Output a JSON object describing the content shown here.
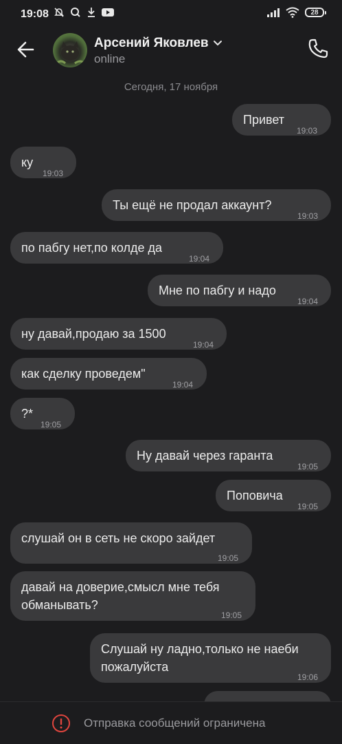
{
  "status_bar": {
    "time": "19:08",
    "battery": "28"
  },
  "header": {
    "contact_name": "Арсений Яковлев",
    "presence": "online"
  },
  "date_separator": "Сегодня, 17 ноября",
  "messages": [
    {
      "dir": "out",
      "text": "Привет",
      "time": "19:03"
    },
    {
      "dir": "in",
      "text": "ку",
      "time": "19:03"
    },
    {
      "dir": "out",
      "text": "Ты ещё не продал аккаунт?",
      "time": "19:03"
    },
    {
      "dir": "in",
      "text": "по пабгу нет,по колде да",
      "time": "19:04"
    },
    {
      "dir": "out",
      "text": "Мне по пабгу и надо",
      "time": "19:04"
    },
    {
      "dir": "in",
      "text": "ну давай,продаю за 1500",
      "time": "19:04"
    },
    {
      "dir": "in",
      "text": "как сделку проведем\"",
      "time": "19:04"
    },
    {
      "dir": "in",
      "text": "?*",
      "time": "19:05"
    },
    {
      "dir": "out",
      "text": "Ну давай через гаранта",
      "time": "19:05"
    },
    {
      "dir": "out",
      "text": "Поповича",
      "time": "19:05"
    },
    {
      "dir": "in",
      "text": "слушай он в сеть не скоро зайдет",
      "time": "19:05"
    },
    {
      "dir": "in",
      "text": "давай на доверие,смысл мне тебя\nобманывать?",
      "time": "19:05"
    },
    {
      "dir": "out",
      "text": "Слушай ну ладно,только не наеби\nпожалуйста",
      "time": "19:06"
    }
  ],
  "bottom_bar": {
    "notice": "Отправка сообщений ограничена"
  }
}
